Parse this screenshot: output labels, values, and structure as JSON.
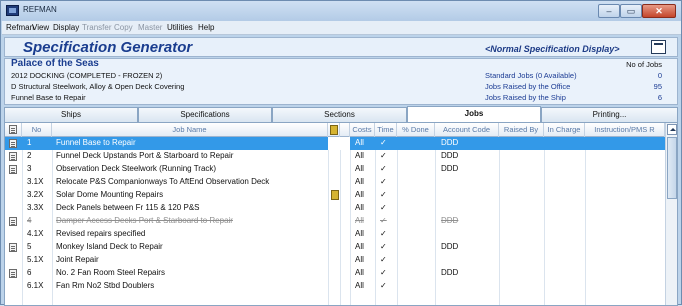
{
  "window": {
    "title": "REFMAN",
    "min_label": "–",
    "max_label": "▭",
    "close_label": "✕"
  },
  "menu": [
    "Refman",
    "View",
    "Display",
    "Transfer",
    "Copy",
    "Master",
    "Utilities",
    "Help"
  ],
  "menu_disabled": [
    false,
    false,
    false,
    true,
    true,
    true,
    false,
    false
  ],
  "header": {
    "title": "Specification Generator",
    "display_mode": "<Normal Specification Display>"
  },
  "ship": {
    "name": "Palace of the Seas",
    "line1": "2012 DOCKING   (COMPLETED - FROZEN 2)",
    "line2": "D Structural Steelwork, Alloy & Open Deck Covering",
    "line3": "Funnel Base to Repair"
  },
  "stats": {
    "header": "No of Jobs",
    "items": [
      {
        "label": "Standard Jobs (0 Available)",
        "value": "0"
      },
      {
        "label": "Jobs Raised by the Office",
        "value": "95"
      },
      {
        "label": "Jobs Raised by the Ship",
        "value": "6"
      }
    ]
  },
  "tabs": [
    "Ships",
    "Specifications",
    "Sections",
    "Jobs",
    "Printing..."
  ],
  "active_tab": "Jobs",
  "columns": [
    "No",
    "Job Name",
    "",
    "",
    "Costs",
    "Time",
    "% Done",
    "Account Code",
    "Raised By",
    "In Charge",
    "Instruction/PMS R"
  ],
  "rows": [
    {
      "no": "1",
      "name": "Funnel Base to Repair",
      "costs": "All",
      "time": "✓",
      "code": "DDD",
      "doc": true,
      "book": false,
      "struck": false,
      "selected": true
    },
    {
      "no": "2",
      "name": "Funnel Deck Upstands Port & Starboard to Repair",
      "costs": "All",
      "time": "✓",
      "code": "DDD",
      "doc": true,
      "book": false,
      "struck": false,
      "selected": false
    },
    {
      "no": "3",
      "name": "Observation Deck Steelwork (Running Track)",
      "costs": "All",
      "time": "✓",
      "code": "DDD",
      "doc": true,
      "book": false,
      "struck": false,
      "selected": false
    },
    {
      "no": "3.1X",
      "name": "Relocate P&S Companionways To AftEnd Observation Deck",
      "costs": "All",
      "time": "✓",
      "code": "",
      "doc": false,
      "book": false,
      "struck": false,
      "selected": false
    },
    {
      "no": "3.2X",
      "name": "Solar Dome Mounting Repairs",
      "costs": "All",
      "time": "✓",
      "code": "",
      "doc": false,
      "book": true,
      "struck": false,
      "selected": false
    },
    {
      "no": "3.3X",
      "name": "Deck Panels between Fr 115 & 120 P&S",
      "costs": "All",
      "time": "✓",
      "code": "",
      "doc": false,
      "book": false,
      "struck": false,
      "selected": false
    },
    {
      "no": "4",
      "name": "Damper Access Decks Port & Starboard to Repair",
      "costs": "All",
      "time": "✓",
      "code": "DDD",
      "doc": true,
      "book": false,
      "struck": true,
      "selected": false
    },
    {
      "no": "4.1X",
      "name": "Revised repairs specified",
      "costs": "All",
      "time": "✓",
      "code": "",
      "doc": false,
      "book": false,
      "struck": false,
      "selected": false
    },
    {
      "no": "5",
      "name": "Monkey Island Deck to Repair",
      "costs": "All",
      "time": "✓",
      "code": "DDD",
      "doc": true,
      "book": false,
      "struck": false,
      "selected": false
    },
    {
      "no": "5.1X",
      "name": "Joint Repair",
      "costs": "All",
      "time": "✓",
      "code": "",
      "doc": false,
      "book": false,
      "struck": false,
      "selected": false
    },
    {
      "no": "6",
      "name": "No. 2 Fan Room Steel Repairs",
      "costs": "All",
      "time": "✓",
      "code": "DDD",
      "doc": true,
      "book": false,
      "struck": false,
      "selected": false
    },
    {
      "no": "6.1X",
      "name": "Fan Rm No2 Stbd Doublers",
      "costs": "All",
      "time": "✓",
      "code": "",
      "doc": false,
      "book": false,
      "struck": false,
      "selected": false
    }
  ]
}
